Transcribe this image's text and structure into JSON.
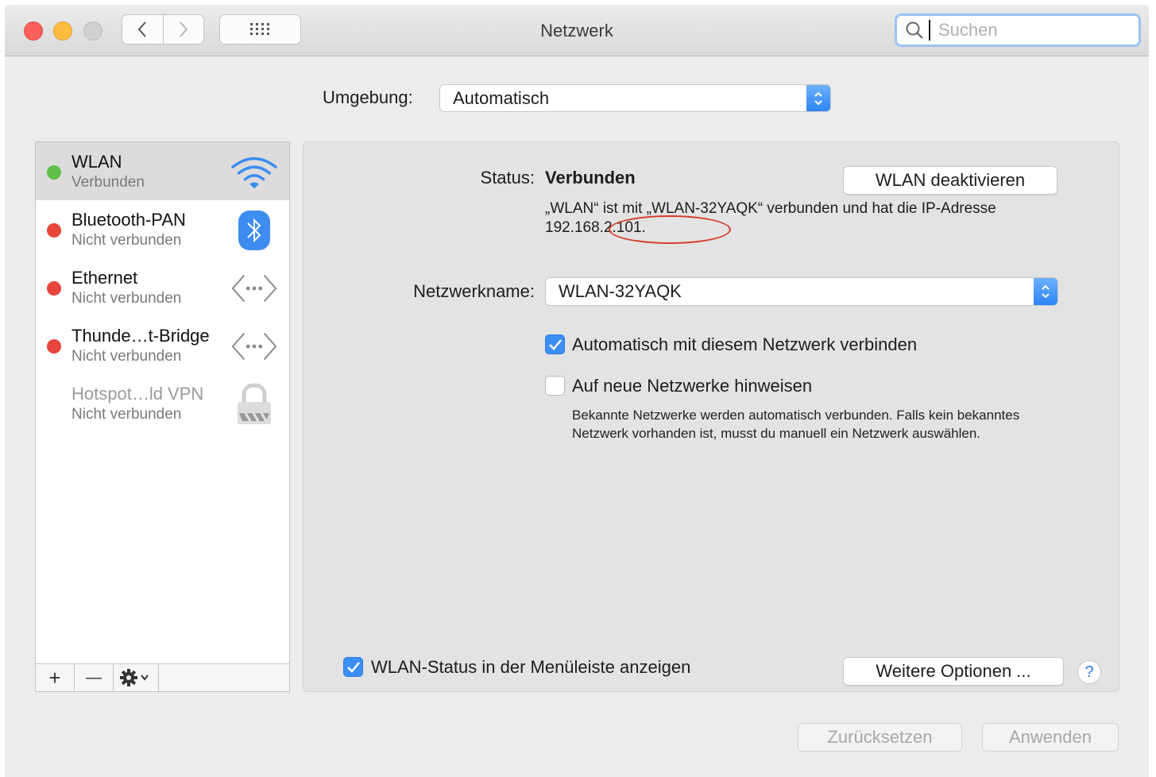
{
  "window": {
    "title": "Netzwerk",
    "search_placeholder": "Suchen"
  },
  "location": {
    "label": "Umgebung:",
    "value": "Automatisch"
  },
  "services": [
    {
      "name": "WLAN",
      "status": "Verbunden",
      "dot_color": "#5fc04a",
      "icon": "wifi-icon",
      "selected": true
    },
    {
      "name": "Bluetooth-PAN",
      "status": "Nicht verbunden",
      "dot_color": "#e8463c",
      "icon": "bluetooth-icon"
    },
    {
      "name": "Ethernet",
      "status": "Nicht verbunden",
      "dot_color": "#e8463c",
      "icon": "ethernet-icon"
    },
    {
      "name": "Thunde…t-Bridge",
      "status": "Nicht verbunden",
      "dot_color": "#e8463c",
      "icon": "thunderbolt-bridge-icon"
    },
    {
      "name": "Hotspot…ld VPN",
      "status": "Nicht verbunden",
      "icon": "vpn-lock-icon"
    }
  ],
  "sidebar_toolbar": {
    "add": "+",
    "remove": "—",
    "action_icon": "gear-icon"
  },
  "detail": {
    "status_label": "Status:",
    "status_value": "Verbunden",
    "wlan_off_button": "WLAN deaktivieren",
    "status_description": "„WLAN“ ist mit „WLAN-32YAQK“ verbunden und hat die IP-Adresse 192.168.2.101.",
    "network_label": "Netzwerkname:",
    "network_value": "WLAN-32YAQK",
    "auto_join_label": "Automatisch mit diesem Netzwerk verbinden",
    "auto_join_checked": true,
    "ask_join_label": "Auf neue Netzwerke hinweisen",
    "ask_join_checked": false,
    "ask_join_hint": "Bekannte Netzwerke werden automatisch verbunden. Falls kein bekanntes Netzwerk vorhanden ist, musst du manuell ein Netzwerk auswählen.",
    "menubar_status_label": "WLAN-Status in der Menüleiste anzeigen",
    "menubar_status_checked": true,
    "more_options_button": "Weitere Optionen ...",
    "help": "?"
  },
  "footer": {
    "reset_button": "Zurücksetzen",
    "apply_button": "Anwenden"
  },
  "colors": {
    "accent": "#3b8ff6",
    "annotation": "#d63a2a"
  }
}
